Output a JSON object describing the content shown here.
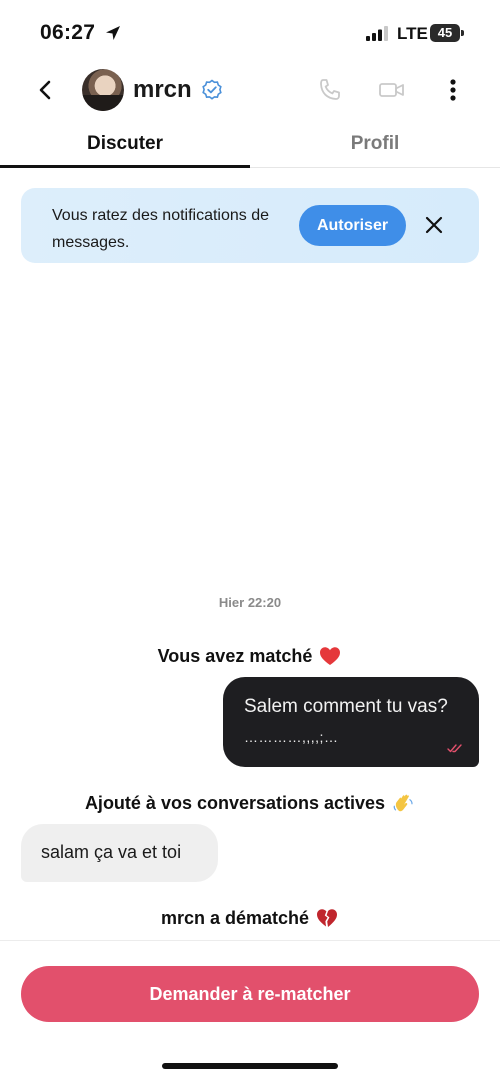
{
  "status_bar": {
    "time": "06:27",
    "network": "LTE",
    "battery": "45",
    "icons": [
      "location-arrow-icon",
      "signal-icon",
      "battery-icon"
    ]
  },
  "header": {
    "contact_name": "mrcn",
    "icons": [
      "back-icon",
      "verified-icon",
      "phone-icon",
      "video-icon",
      "more-icon"
    ]
  },
  "tabs": [
    {
      "label": "Discuter",
      "active": true
    },
    {
      "label": "Profil",
      "active": false
    }
  ],
  "notification": {
    "text": "Vous ratez des notifications de messages.",
    "allow_label": "Autoriser",
    "accent": "#3f8ee8"
  },
  "chat": {
    "timestamp": "Hier 22:20",
    "matched": "Vous avez matché",
    "outgoing_line1": "Salem comment tu vas?",
    "outgoing_line2": "…………,,,,;…",
    "added": "Ajouté à vos conversations actives",
    "incoming": "salam ça va et toi",
    "unmatched": "mrcn a dématché"
  },
  "actions": {
    "rematch_label": "Demander à re-matcher",
    "rematch_color": "#e2506c"
  }
}
